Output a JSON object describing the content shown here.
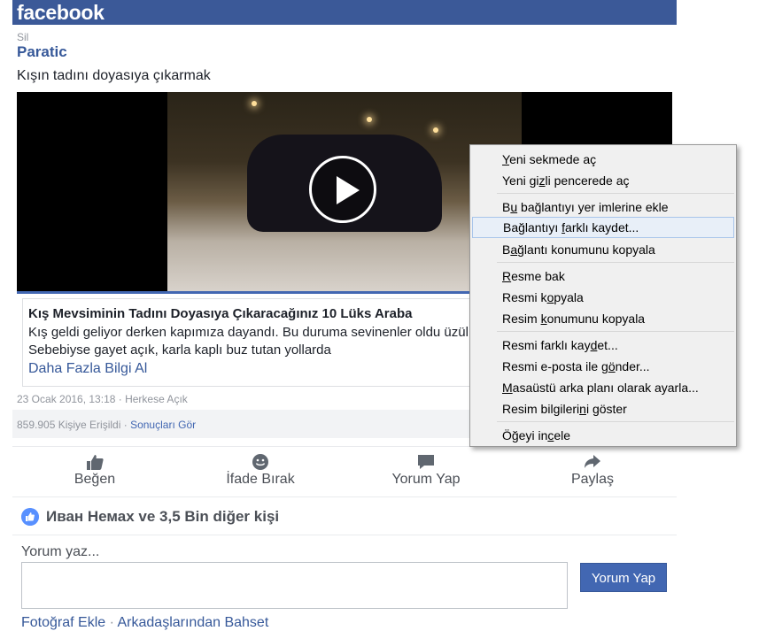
{
  "header": {
    "logo_text": "facebook"
  },
  "post": {
    "delete_label": "Sil",
    "page_name": "Paratic",
    "text": "Kışın tadını doyasıya çıkarmak",
    "link": {
      "title": "Kış Mevsiminin Tadını Doyasıya Çıkaracağınız 10 Lüks Araba",
      "description": "Kış geldi geliyor derken kapımıza dayandı. Bu duruma sevinenler oldu üzülüyor. Sebebiyse gayet açık, karla kaplı buz tutan yollarda",
      "more": "Daha Fazla Bilgi Al"
    },
    "meta": "23 Ocak 2016, 13:18 · Herkese Açık",
    "reach": "859.905 Kişiye Erişildi",
    "reach_sep": " · ",
    "results_link": "Sonuçları Gör",
    "actions": {
      "like": "Beğen",
      "react": "İfade Bırak",
      "comment": "Yorum Yap",
      "share": "Paylaş"
    },
    "likes_text": "Иван Немах ve 3,5 Bin diğer kişi",
    "comment_label": "Yorum yaz...",
    "comment_button": "Yorum Yap",
    "links": {
      "add_photo": "Fotoğraf Ekle",
      "sep": " · ",
      "mention": "Arkadaşlarından Bahset"
    }
  },
  "context_menu": {
    "highlight_color": "#e8eff8",
    "items": [
      {
        "pre": "",
        "u": "Y",
        "post": "eni sekmede aç"
      },
      {
        "pre": "Yeni gi",
        "u": "z",
        "post": "li pencerede aç"
      },
      {
        "pre": "B",
        "u": "u",
        "post": " bağlantıyı yer imlerine ekle"
      },
      {
        "pre": "Bağlantıyı ",
        "u": "f",
        "post": "arklı kaydet..."
      },
      {
        "pre": "B",
        "u": "a",
        "post": "ğlantı konumunu kopyala"
      },
      {
        "pre": "",
        "u": "R",
        "post": "esme bak"
      },
      {
        "pre": "Resmi k",
        "u": "o",
        "post": "pyala"
      },
      {
        "pre": "Resim ",
        "u": "k",
        "post": "onumunu kopyala"
      },
      {
        "pre": "Resmi farklı kay",
        "u": "d",
        "post": "et..."
      },
      {
        "pre": "Resmi e-posta ile g",
        "u": "ö",
        "post": "nder..."
      },
      {
        "pre": "",
        "u": "M",
        "post": "asaüstü arka planı olarak ayarla..."
      },
      {
        "pre": "Resim bilgileri",
        "u": "n",
        "post": "i göster"
      },
      {
        "pre": "Öğeyi in",
        "u": "c",
        "post": "ele"
      }
    ]
  }
}
